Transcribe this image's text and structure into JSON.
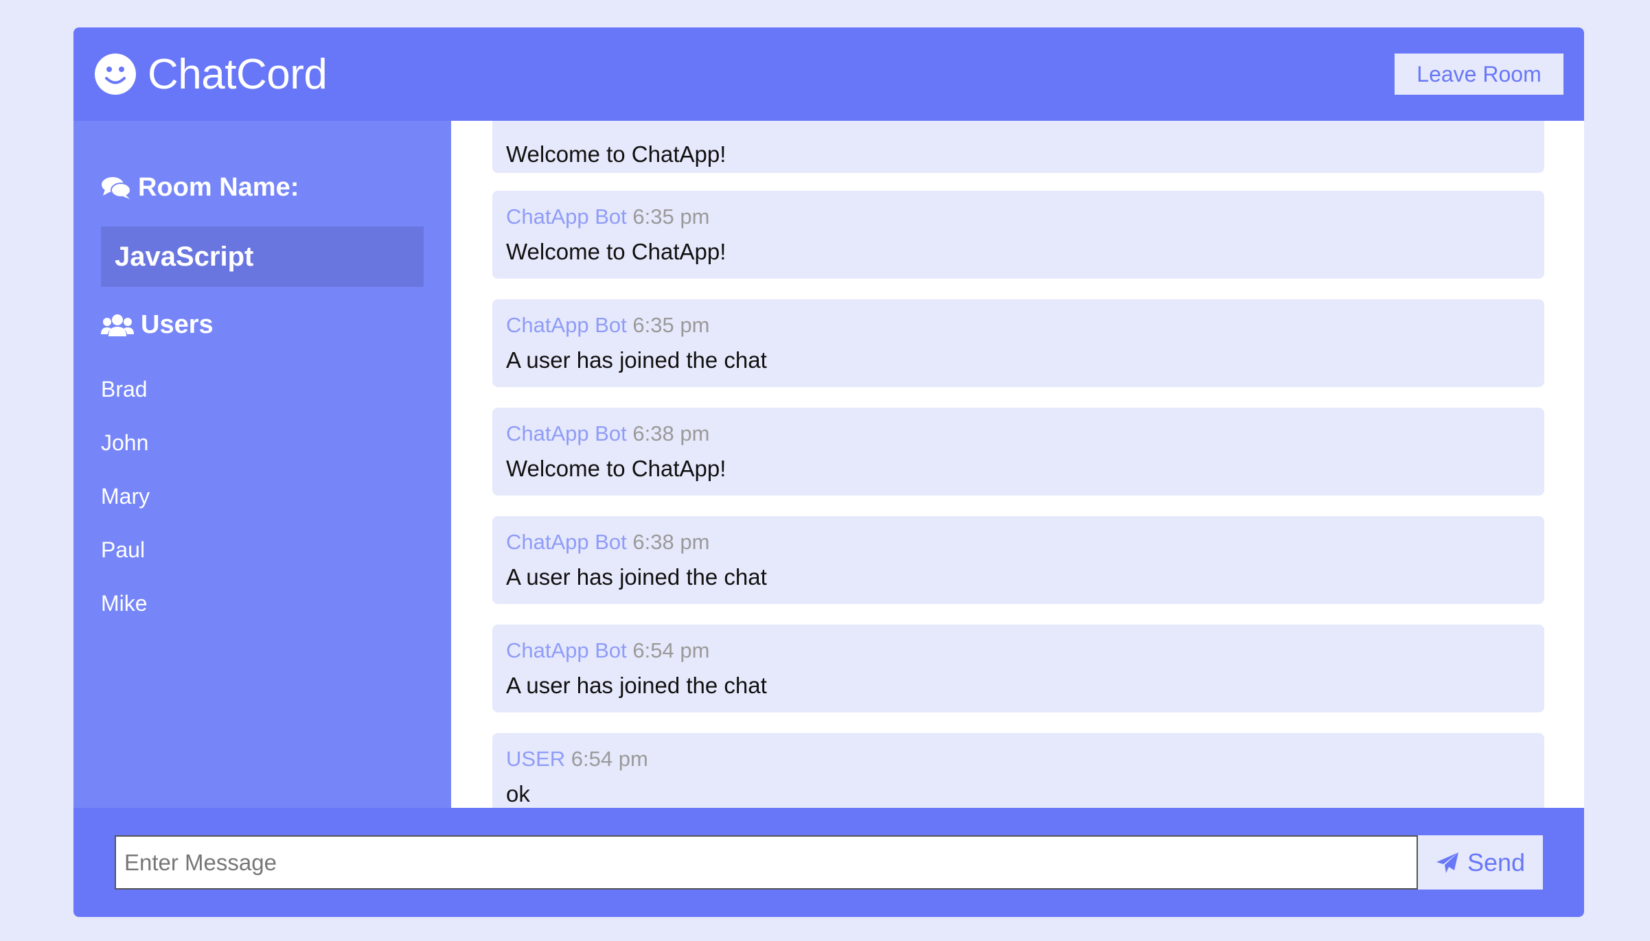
{
  "header": {
    "brand": "ChatCord",
    "leave_label": "Leave Room"
  },
  "sidebar": {
    "room_heading": "Room Name:",
    "room_name": "JavaScript",
    "users_heading": "Users",
    "users": [
      "Brad",
      "John",
      "Mary",
      "Paul",
      "Mike"
    ]
  },
  "messages": [
    {
      "author": "",
      "time": "",
      "text": "Welcome to ChatApp!"
    },
    {
      "author": "ChatApp Bot",
      "time": "6:35 pm",
      "text": "Welcome to ChatApp!"
    },
    {
      "author": "ChatApp Bot",
      "time": "6:35 pm",
      "text": "A user has joined the chat"
    },
    {
      "author": "ChatApp Bot",
      "time": "6:38 pm",
      "text": "Welcome to ChatApp!"
    },
    {
      "author": "ChatApp Bot",
      "time": "6:38 pm",
      "text": "A user has joined the chat"
    },
    {
      "author": "ChatApp Bot",
      "time": "6:54 pm",
      "text": "A user has joined the chat"
    },
    {
      "author": "USER",
      "time": "6:54 pm",
      "text": "ok"
    }
  ],
  "composer": {
    "placeholder": "Enter Message",
    "value": "",
    "send_label": "Send"
  },
  "colors": {
    "primary": "#6877f8",
    "sidebar": "#7686f8",
    "light": "#e6e9fb",
    "author": "#8f9cf8"
  },
  "icons": {
    "brand": "smile-icon",
    "room": "comments-icon",
    "users": "users-icon",
    "send": "paper-plane-icon"
  }
}
